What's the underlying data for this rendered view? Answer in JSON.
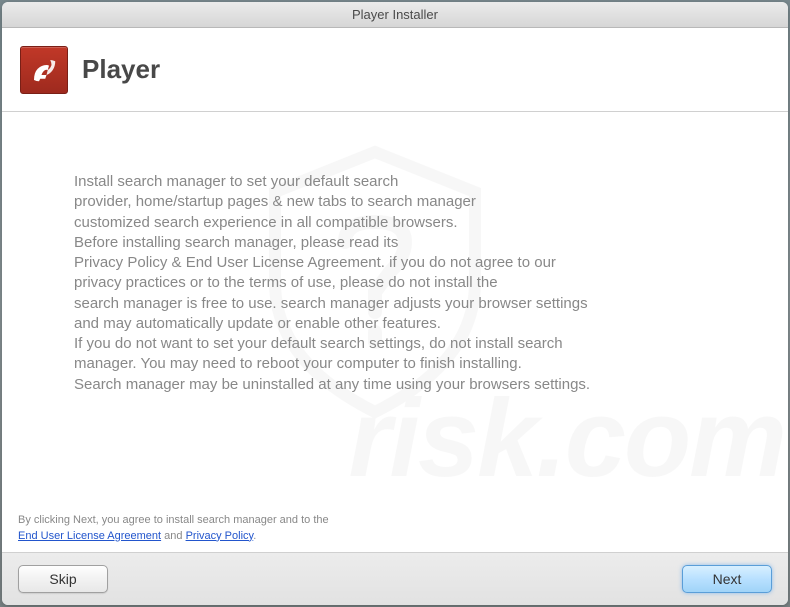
{
  "window": {
    "title": "Player Installer"
  },
  "header": {
    "title": "Player",
    "icon_name": "flash-player-icon"
  },
  "body": {
    "text": "Install search manager to set your default search\nprovider, home/startup pages & new tabs to search manager\ncustomized search experience in all compatible browsers.\nBefore installing search manager, please read its\nPrivacy Policy & End User License Agreement. if you do not agree to our\nprivacy practices or to the terms of use, please do not install the\nsearch manager is free to use. search manager adjusts your browser settings\nand may automatically update or enable other features.\nIf you do not want to set your default search settings, do not install search\nmanager. You may need to reboot your computer to finish installing.\nSearch manager may be uninstalled at any time using your browsers settings."
  },
  "footer": {
    "notice_prefix": "By clicking Next, you agree to install search manager and to the",
    "eula_link": "End User License Agreement",
    "and_text": " and ",
    "privacy_link": "Privacy Policy",
    "suffix": "."
  },
  "buttons": {
    "skip_label": "Skip",
    "next_label": "Next"
  }
}
